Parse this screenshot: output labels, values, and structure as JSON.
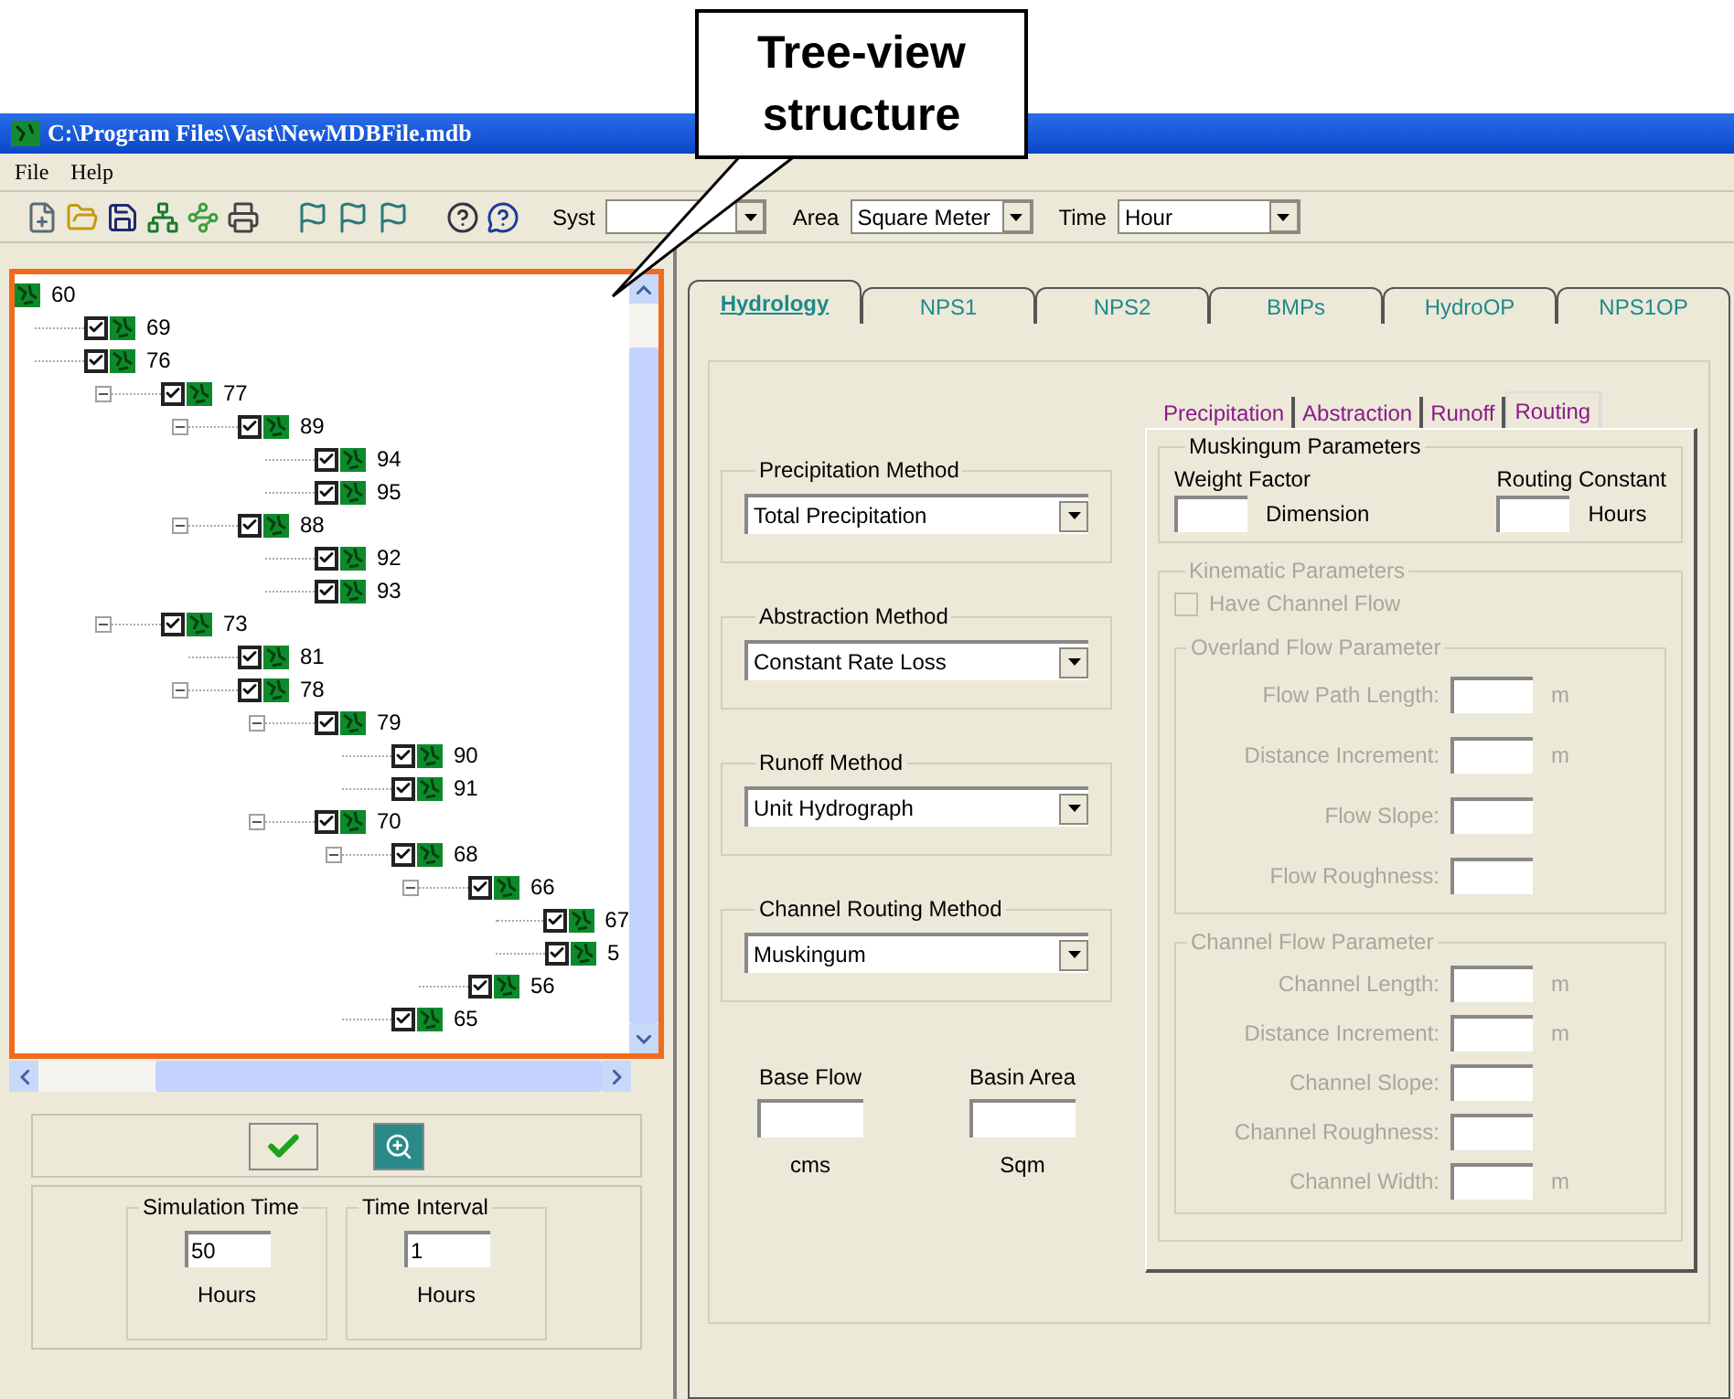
{
  "annotation": {
    "text": "Tree-view structure"
  },
  "window": {
    "title": "C:\\Program Files\\Vast\\NewMDBFile.mdb"
  },
  "menu": [
    {
      "label": "File"
    },
    {
      "label": "Help"
    }
  ],
  "unit_selectors": [
    {
      "label": "Syst"
    },
    {
      "label": "Area",
      "value": "Square Meter"
    },
    {
      "label": "Time",
      "value": "Hour"
    }
  ],
  "tree": {
    "label": "60",
    "children": [
      {
        "label": "69",
        "checked": true
      },
      {
        "label": "76",
        "checked": true,
        "children": [
          {
            "label": "77",
            "checked": true,
            "expanded": true,
            "children": [
              {
                "label": "89",
                "checked": true,
                "expanded": true,
                "children": [
                  {
                    "label": "94",
                    "checked": true
                  },
                  {
                    "label": "95",
                    "checked": true
                  }
                ]
              },
              {
                "label": "88",
                "checked": true,
                "expanded": true,
                "children": [
                  {
                    "label": "92",
                    "checked": true
                  },
                  {
                    "label": "93",
                    "checked": true
                  }
                ]
              }
            ]
          },
          {
            "label": "73",
            "checked": true,
            "expanded": true,
            "children": [
              {
                "label": "81",
                "checked": true
              },
              {
                "label": "78",
                "checked": true,
                "expanded": true,
                "children": [
                  {
                    "label": "79",
                    "checked": true,
                    "expanded": true,
                    "children": [
                      {
                        "label": "90",
                        "checked": true
                      },
                      {
                        "label": "91",
                        "checked": true
                      }
                    ]
                  },
                  {
                    "label": "70",
                    "checked": true,
                    "expanded": true,
                    "children": [
                      {
                        "label": "68",
                        "checked": true,
                        "expanded": true,
                        "children": [
                          {
                            "label": "66",
                            "checked": true,
                            "expanded": true,
                            "children": [
                              {
                                "label": "67",
                                "checked": true
                              },
                              {
                                "label": "5",
                                "checked": true
                              }
                            ]
                          },
                          {
                            "label": "56",
                            "checked": true
                          }
                        ]
                      },
                      {
                        "label": "65",
                        "checked": true
                      }
                    ]
                  }
                ]
              }
            ]
          }
        ]
      }
    ]
  },
  "simulation": [
    {
      "label": "Simulation Time",
      "value": "50",
      "unit": "Hours"
    },
    {
      "label": "Time Interval",
      "value": "1",
      "unit": "Hours"
    }
  ],
  "tabs": [
    {
      "label": "Hydrology",
      "selected": true
    },
    {
      "label": "NPS1",
      "selected": false
    },
    {
      "label": "NPS2",
      "selected": false
    },
    {
      "label": "BMPs",
      "selected": false
    },
    {
      "label": "HydroOP",
      "selected": false
    },
    {
      "label": "NPS1OP",
      "selected": false
    }
  ],
  "methods": [
    {
      "label": "Precipitation Method",
      "value": "Total Precipitation"
    },
    {
      "label": "Abstraction Method",
      "value": "Constant Rate Loss"
    },
    {
      "label": "Runoff Method",
      "value": "Unit Hydrograph"
    },
    {
      "label": "Channel Routing Method",
      "value": "Muskingum"
    }
  ],
  "basin_fields": [
    {
      "label": "Base Flow",
      "unit": "cms"
    },
    {
      "label": "Basin Area",
      "unit": "Sqm"
    }
  ],
  "sub_tabs": [
    {
      "label": "Precipitation",
      "selected": false
    },
    {
      "label": "Abstraction",
      "selected": false
    },
    {
      "label": "Runoff",
      "selected": false
    },
    {
      "label": "Routing",
      "selected": true
    }
  ],
  "muskingum": {
    "title": "Muskingum Parameters",
    "fields": [
      {
        "label": "Weight Factor",
        "unit": "Dimension"
      },
      {
        "label": "Routing Constant",
        "unit": "Hours"
      }
    ]
  },
  "kinematic": {
    "title": "Kinematic Parameters",
    "disabled": true,
    "checkbox": {
      "label": "Have Channel Flow",
      "checked": false
    },
    "groups": [
      {
        "title": "Overland Flow Parameter",
        "fields": [
          {
            "label": "Flow Path Length:",
            "unit": "m"
          },
          {
            "label": "Distance Increment:",
            "unit": "m"
          },
          {
            "label": "Flow Slope:"
          },
          {
            "label": "Flow Roughness:"
          }
        ]
      },
      {
        "title": "Channel Flow Parameter",
        "fields": [
          {
            "label": "Channel Length:",
            "unit": "m"
          },
          {
            "label": "Distance Increment:",
            "unit": "m"
          },
          {
            "label": "Channel Slope:"
          },
          {
            "label": "Channel Roughness:"
          },
          {
            "label": "Channel Width:",
            "unit": "m"
          }
        ]
      }
    ]
  }
}
